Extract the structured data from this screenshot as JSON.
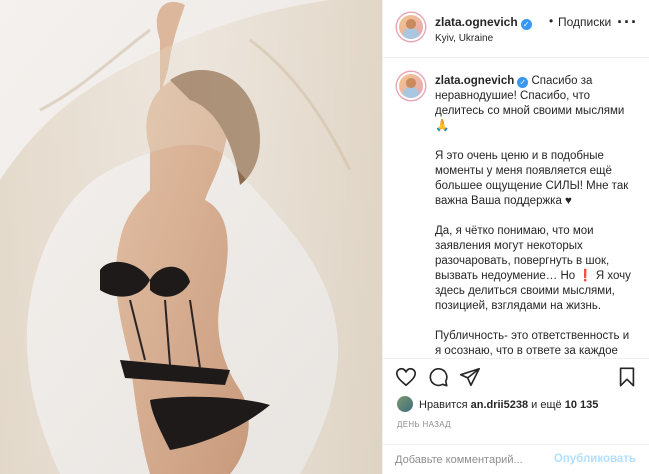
{
  "header": {
    "username": "zlata.ognevich",
    "separator": "•",
    "follow_label": "Подписки",
    "location": "Kyiv, Ukraine",
    "more_label": "···"
  },
  "caption": {
    "username": "zlata.ognevich",
    "paragraphs": [
      "Спасибо за неравнодушие! Спасибо, что делитесь со мной своими мыслями 🙏",
      "Я это очень ценю и в подобные моменты у меня появляется ещё большее ощущение СИЛЫ! Мне так важна Ваша поддержка ♥",
      "Да, я чётко понимаю, что мои заявления могут некоторых разочаровать, повергнуть в шок, вызвать недоумение… Но ❗ Я хочу здесь делиться своими мыслями, позицией, взглядами на жизнь.",
      "Публичность- это ответственность и я осознаю, что в ответе за каждое слово. Но это меня не остановит и далее озвучивать и отстаивать свои"
    ]
  },
  "likes": {
    "prefix": "Нравится",
    "user": "an.drii5238",
    "conj": "и ещё",
    "count": "10 135"
  },
  "time": "ДЕНЬ НАЗАД",
  "comment": {
    "placeholder": "Добавьте комментарий...",
    "post_label": "Опубликовать"
  },
  "colors": {
    "verified": "#3897f0",
    "post_disabled": "#b2dffc",
    "muted": "#8e8e8e"
  }
}
